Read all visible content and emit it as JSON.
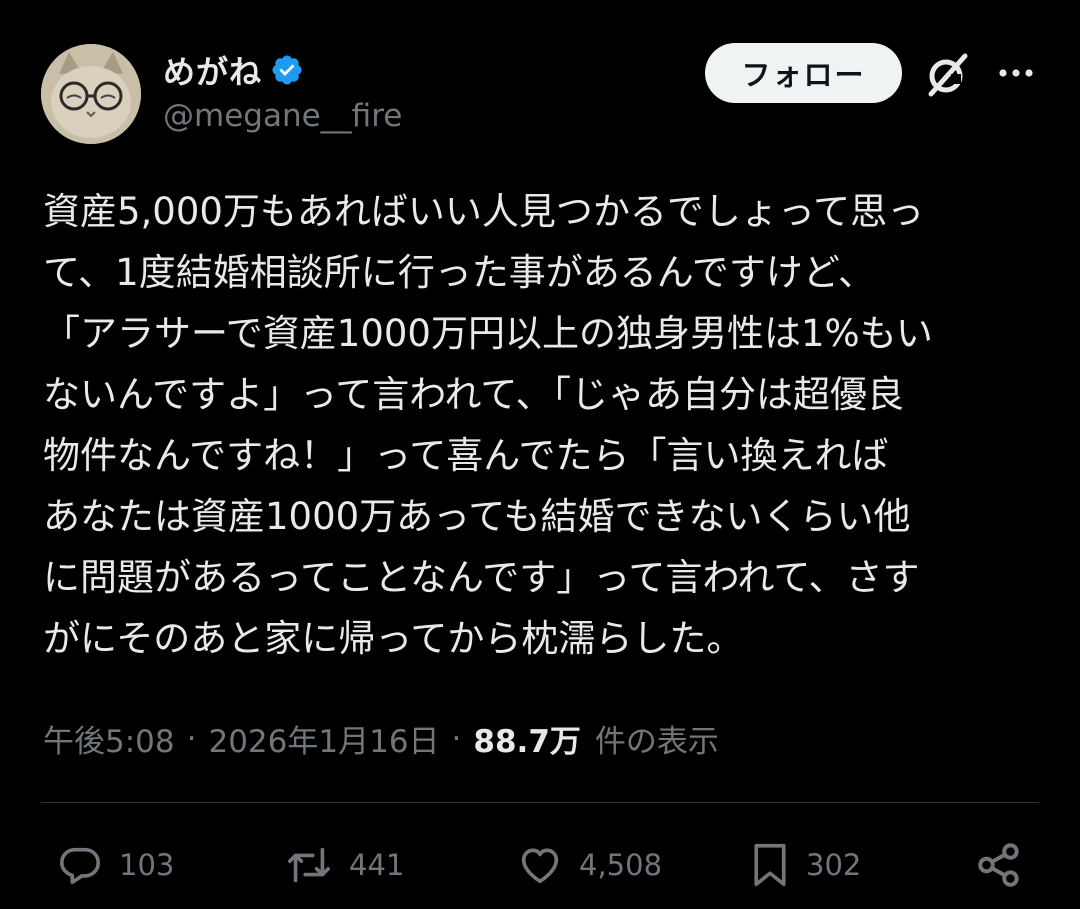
{
  "author": {
    "display_name": "めがね",
    "handle": "@megane__fire",
    "verified": true,
    "verified_color": "#1d9bf0"
  },
  "header": {
    "follow_label": "フォロー",
    "grok_icon": "grok-icon",
    "more_icon": "more-icon"
  },
  "tweet": {
    "lines": [
      "資産5,000万もあればいい人見つかるでしょって思っ",
      "て、1度結婚相談所に行った事があるんですけど、",
      "「アラサーで資産1000万円以上の独身男性は1%もい",
      "ないんですよ」って言われて、「じゃあ自分は超優良",
      "物件なんですね！」って喜んでたら「言い換えれば",
      "あなたは資産1000万あっても結婚できないくらい他",
      "に問題があるってことなんです」って言われて、さす",
      "がにそのあと家に帰ってから枕濡らした。"
    ]
  },
  "meta": {
    "time": "午後5:08",
    "separator": "·",
    "date": "2026年1月16日",
    "views_count": "88.7万",
    "views_label": "件の表示"
  },
  "actions": {
    "replies": "103",
    "reposts": "441",
    "likes": "4,508",
    "bookmarks": "302"
  },
  "colors": {
    "background": "#000000",
    "text_primary": "#e7e9ea",
    "text_secondary": "#71767b",
    "divider": "#2f3336"
  }
}
